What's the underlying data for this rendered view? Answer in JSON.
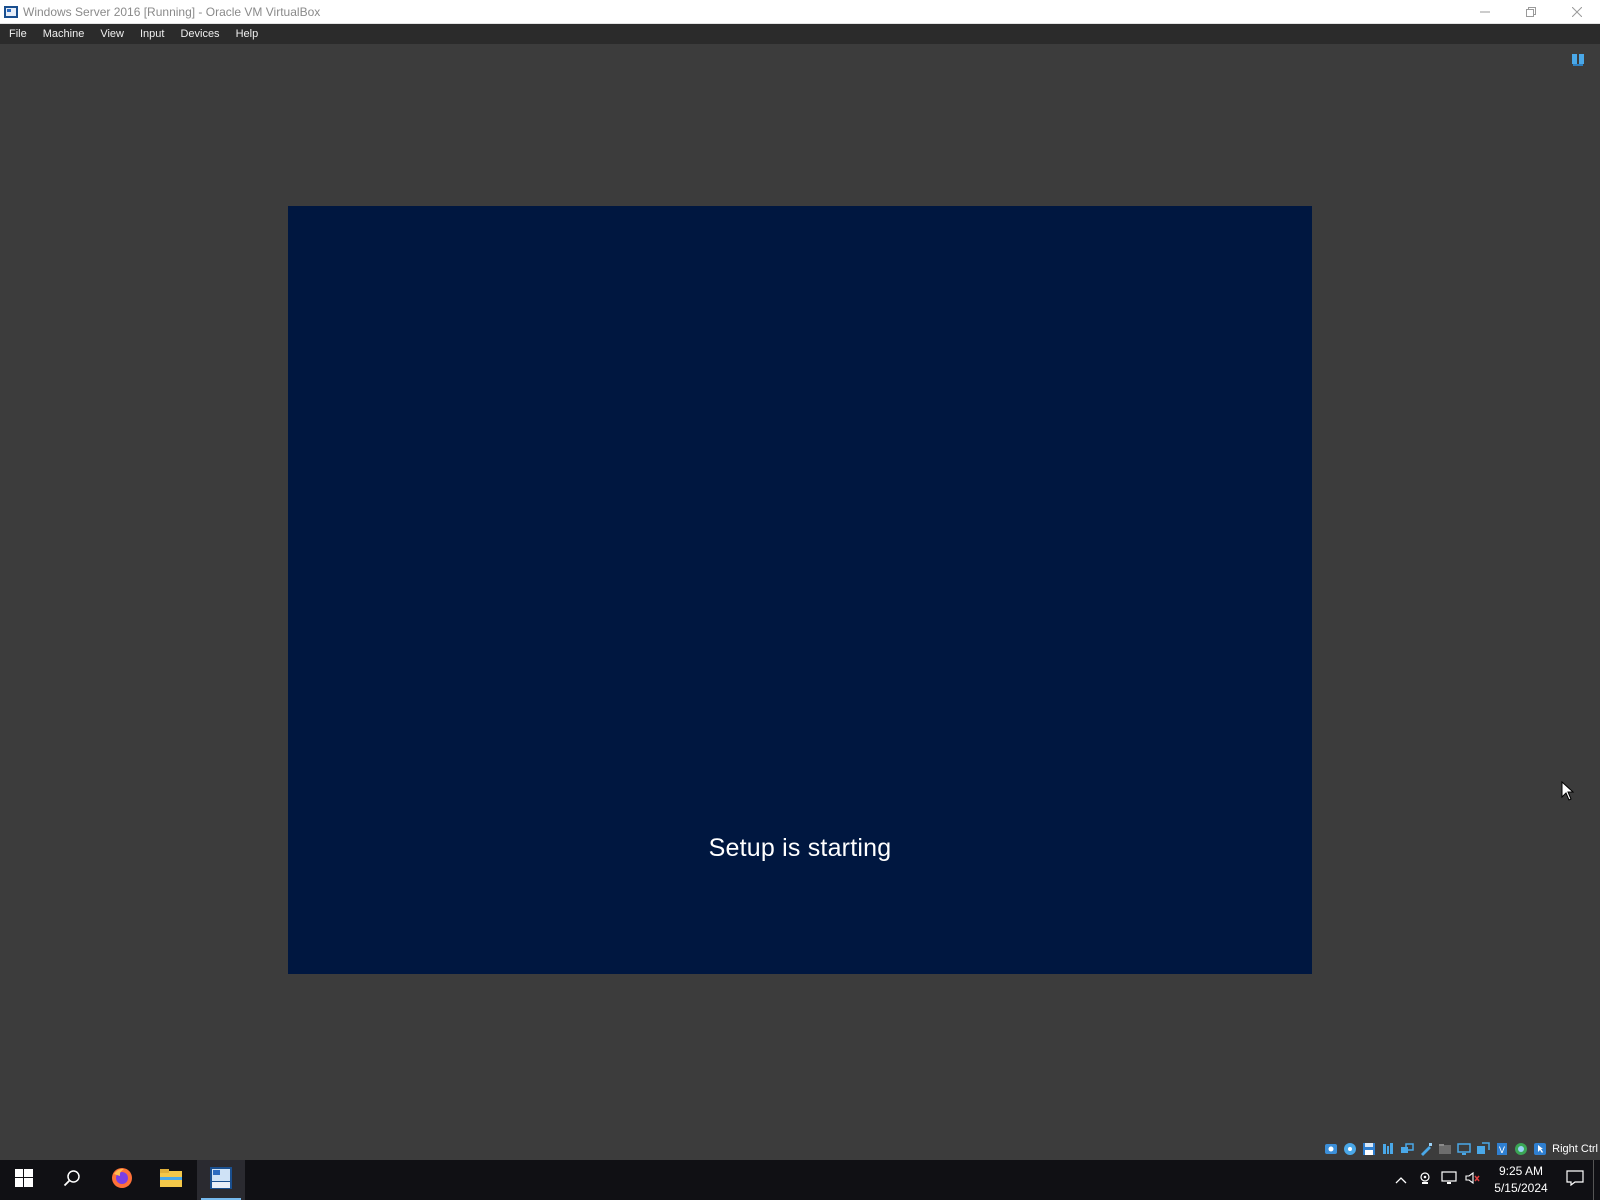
{
  "window": {
    "title": "Windows Server 2016 [Running] - Oracle VM VirtualBox",
    "controls": {
      "minimize": "—",
      "restore": "❐",
      "close": "✕"
    }
  },
  "menu": {
    "items": [
      "File",
      "Machine",
      "View",
      "Input",
      "Devices",
      "Help"
    ]
  },
  "vm": {
    "message": "Setup is starting",
    "background_color": "#001740"
  },
  "statusbar": {
    "icons": [
      "hard-disk-icon",
      "optical-disk-icon",
      "floppy-icon",
      "audio-icon",
      "network-icon",
      "usb-icon",
      "shared-folders-icon",
      "display-icon",
      "recording-icon",
      "vt-x-icon",
      "guest-additions-icon",
      "mouse-integration-icon"
    ],
    "host_key": "Right Ctrl"
  },
  "taskbar": {
    "apps": [
      "start-icon",
      "search-icon",
      "firefox-icon",
      "file-explorer-icon",
      "virtualbox-icon"
    ],
    "active_app": "virtualbox-icon",
    "clock": {
      "time": "9:25 AM",
      "date": "5/15/2024"
    }
  }
}
